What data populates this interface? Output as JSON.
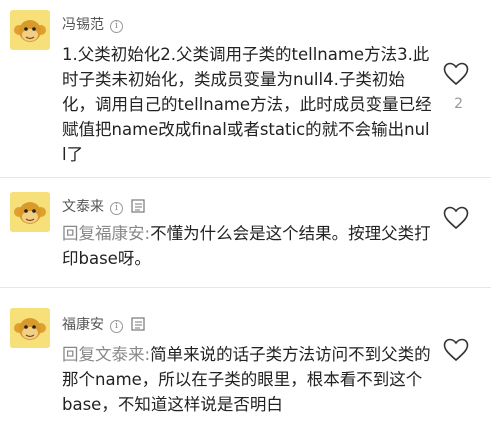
{
  "comments": [
    {
      "name": "冯锡范",
      "text": "1.父类初始化2.父类调用子类的tellname方法3.此时子类未初始化，类成员变量为null4.子类初始化，调用自己的tellname方法，此时成员变量已经赋值把name改成final或者static的就不会输出null了",
      "reply_prefix": "",
      "likes": "2"
    },
    {
      "name": "文泰来",
      "text": "不懂为什么会是这个结果。按理父类打印base呀。",
      "reply_prefix": "回复福康安:",
      "likes": ""
    },
    {
      "name": "福康安",
      "text": "简单来说的话子类方法访问不到父类的那个name，所以在子类的眼里，根本看不到这个base，不知道这样说是否明白",
      "reply_prefix": "回复文泰来:",
      "likes": ""
    }
  ],
  "icons": {
    "avatar": "monkey-avatar-icon",
    "info": "info-icon",
    "reply": "reply-icon",
    "like": "heart-icon"
  },
  "colors": {
    "avatar_bg": "#f7e07a",
    "reply_prefix": "#888888"
  }
}
